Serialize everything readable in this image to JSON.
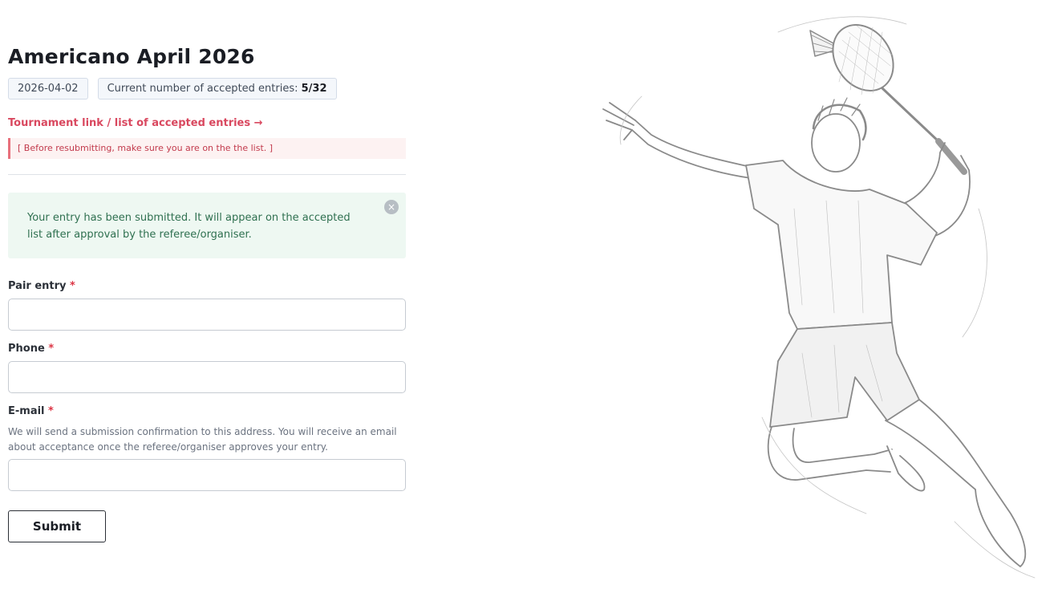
{
  "page": {
    "title": "Americano April 2026"
  },
  "chips": {
    "date": "2026-04-02",
    "entries_label": "Current number of accepted entries: ",
    "entries_value": "5/32"
  },
  "tournament_link": "Tournament link / list of accepted entries →",
  "notice": "[ Before resubmitting, make sure you are on the the list. ]",
  "alert": {
    "message": "Your entry has been submitted. It will appear on the accepted list after approval by the referee/organiser.",
    "close_glyph": "×"
  },
  "form": {
    "required_mark": "*",
    "pair_entry": {
      "label": "Pair entry",
      "value": ""
    },
    "phone": {
      "label": "Phone",
      "value": ""
    },
    "email": {
      "label": "E-mail",
      "help": "We will send a submission confirmation to this address. You will receive an email about acceptance once the referee/organiser approves your entry.",
      "value": ""
    },
    "submit_label": "Submit"
  },
  "colors": {
    "accent": "#d9485f",
    "success_bg": "#eef8f2",
    "success_text": "#2f7050",
    "sketch_stroke": "#8a8a8a"
  },
  "illustration": {
    "icon": "badminton-player-sketch"
  }
}
